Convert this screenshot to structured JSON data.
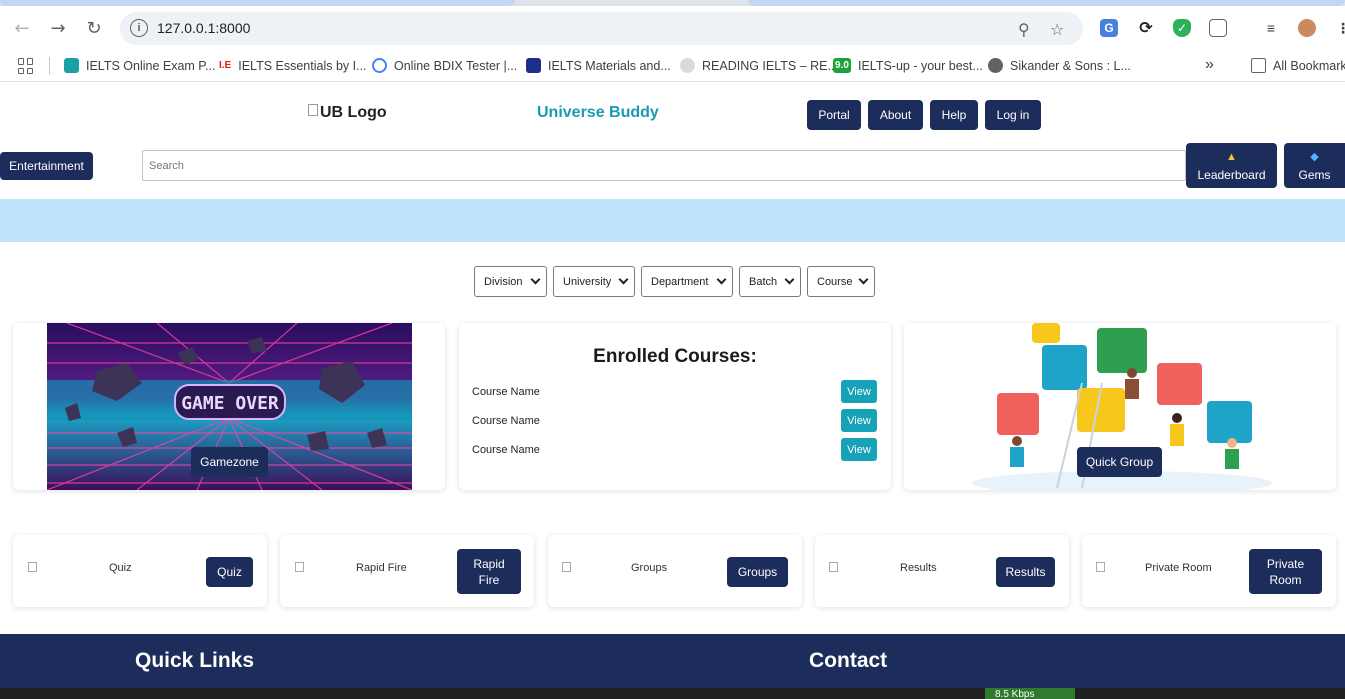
{
  "browser": {
    "url": "127.0.0.1:8000",
    "bookmarks": [
      {
        "label": "IELTS Online Exam P...",
        "favicon": "ielts-online-icon",
        "color": "#1aa1a6"
      },
      {
        "label": "IELTS Essentials by I...",
        "favicon": "ielts-essentials-icon",
        "color": "#e02020"
      },
      {
        "label": "Online BDIX Tester |...",
        "favicon": "google-icon",
        "color": "#4285f4"
      },
      {
        "label": "IELTS Materials and...",
        "favicon": "ielts-materials-icon",
        "color": "#1c2f8c"
      },
      {
        "label": "READING IELTS – RE...",
        "favicon": "reading-ielts-icon",
        "color": "#9aa0a6"
      },
      {
        "label": "IELTS-up - your best...",
        "favicon": "ielts-up-icon",
        "color": "#1aa33b"
      },
      {
        "label": "Sikander & Sons : L...",
        "favicon": "globe-icon",
        "color": "#5f6368"
      }
    ],
    "more_bookmarks": "»",
    "all_bookmarks": "All Bookmark",
    "fav_text": {
      "ie": "I.E",
      "up": "9.0"
    }
  },
  "header": {
    "logo_alt": "UB Logo",
    "brand": "Universe Buddy",
    "nav": [
      "Portal",
      "About",
      "Help",
      "Log in"
    ]
  },
  "toolbar": {
    "entertainment": "Entertainment",
    "search_placeholder": "Search",
    "leaderboard": "Leaderboard",
    "gems": "Gems"
  },
  "filters": [
    "Division",
    "University",
    "Department",
    "Batch",
    "Course"
  ],
  "gamezone": {
    "banner_text": "GAME OVER",
    "button": "Gamezone"
  },
  "enrolled": {
    "title": "Enrolled Courses:",
    "courses": [
      {
        "name": "Course Name",
        "action": "View"
      },
      {
        "name": "Course Name",
        "action": "View"
      },
      {
        "name": "Course Name",
        "action": "View"
      }
    ]
  },
  "quick_group": {
    "button": "Quick Group"
  },
  "features": [
    {
      "alt": "Quiz",
      "button": "Quiz"
    },
    {
      "alt": "Rapid Fire",
      "button": "Rapid Fire"
    },
    {
      "alt": "Groups",
      "button": "Groups"
    },
    {
      "alt": "Results",
      "button": "Results"
    },
    {
      "alt": "Private Room",
      "button": "Private Room"
    }
  ],
  "footer": {
    "quick_links": "Quick Links",
    "contact": "Contact"
  },
  "taskbar": {
    "speed": "8.5 Kbps"
  },
  "colors": {
    "navy": "#1c2c5b",
    "teal": "#17a2b8",
    "brand": "#1a9ab5",
    "banner": "#bfe3fb"
  }
}
